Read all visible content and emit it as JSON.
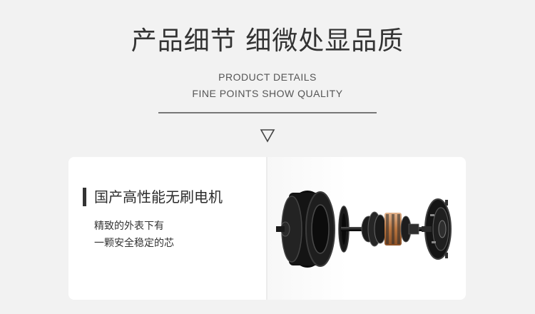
{
  "header": {
    "title": "产品细节 细微处显品质",
    "subtitle_line1": "PRODUCT DETAILS",
    "subtitle_line2": "FINE POINTS SHOW QUALITY"
  },
  "feature": {
    "title": "国产高性能无刷电机",
    "desc_line1": "精致的外表下有",
    "desc_line2": "一颗安全稳定的芯"
  },
  "colors": {
    "background": "#f2f2f2",
    "card": "#ffffff",
    "text": "#333333",
    "motor_black": "#1a1a1a",
    "copper": "#c4855a"
  },
  "icons": {
    "down_arrow": "down-triangle-outline-icon"
  }
}
